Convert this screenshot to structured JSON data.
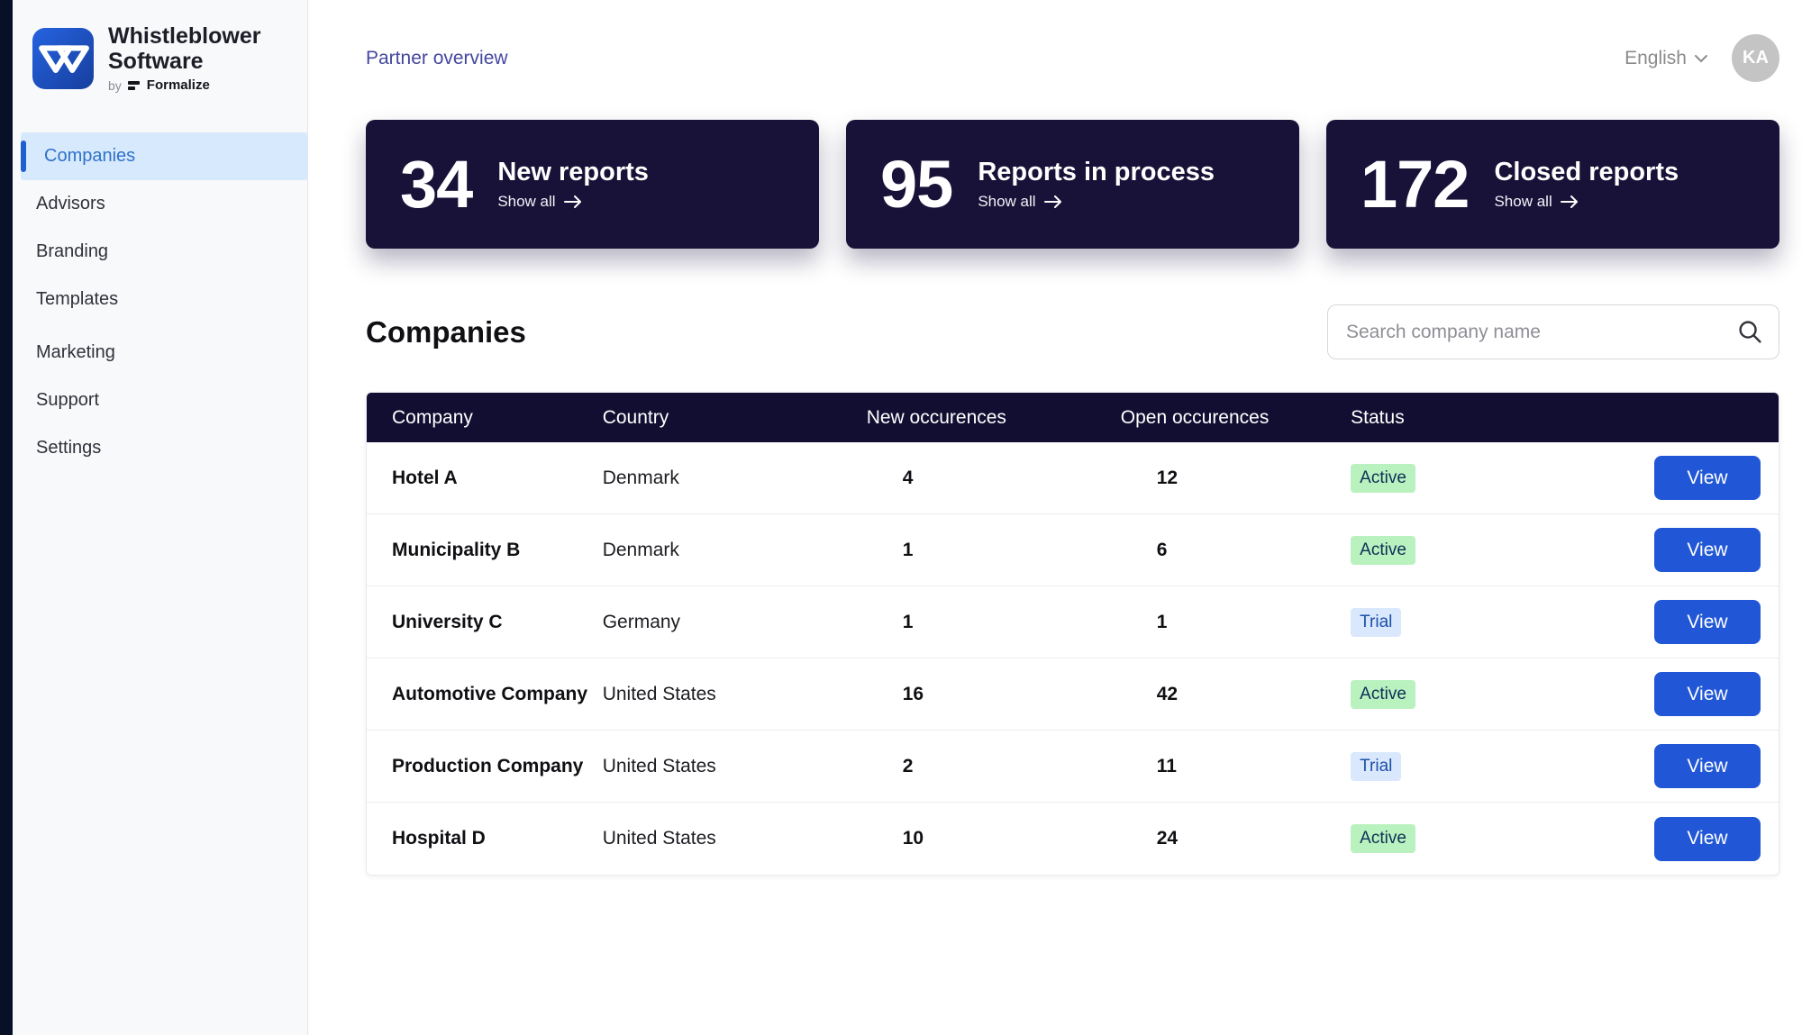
{
  "brand": {
    "name_line1": "Whistleblower",
    "name_line2": "Software",
    "byline_prefix": "by",
    "byline_brand": "Formalize"
  },
  "sidebar": {
    "items": [
      {
        "label": "Companies",
        "active": true
      },
      {
        "label": "Advisors"
      },
      {
        "label": "Branding"
      },
      {
        "label": "Templates"
      },
      {
        "label": "Marketing"
      },
      {
        "label": "Support"
      },
      {
        "label": "Settings"
      }
    ]
  },
  "topbar": {
    "breadcrumb": "Partner overview",
    "language": "English",
    "avatar_initials": "KA"
  },
  "stat_cards": [
    {
      "value": "34",
      "title": "New reports",
      "link_label": "Show all"
    },
    {
      "value": "95",
      "title": "Reports in process",
      "link_label": "Show all"
    },
    {
      "value": "172",
      "title": "Closed reports",
      "link_label": "Show all"
    }
  ],
  "companies_section": {
    "heading": "Companies",
    "search_placeholder": "Search company name"
  },
  "table": {
    "columns": [
      "Company",
      "Country",
      "New occurences",
      "Open occurences",
      "Status"
    ],
    "action_label": "View",
    "rows": [
      {
        "company": "Hotel A",
        "country": "Denmark",
        "new_occurences": "4",
        "open_occurences": "12",
        "status": "Active"
      },
      {
        "company": "Municipality B",
        "country": "Denmark",
        "new_occurences": "1",
        "open_occurences": "6",
        "status": "Active"
      },
      {
        "company": "University C",
        "country": "Germany",
        "new_occurences": "1",
        "open_occurences": "1",
        "status": "Trial"
      },
      {
        "company": "Automotive Company",
        "country": "United States",
        "new_occurences": "16",
        "open_occurences": "42",
        "status": "Active"
      },
      {
        "company": "Production Company",
        "country": "United States",
        "new_occurences": "2",
        "open_occurences": "11",
        "status": "Trial"
      },
      {
        "company": "Hospital D",
        "country": "United States",
        "new_occurences": "10",
        "open_occurences": "24",
        "status": "Active"
      }
    ]
  },
  "colors": {
    "accent": "#2157d7",
    "navy-card": "#181238",
    "navy-header": "#110e31",
    "sidebar-active-text": "#2e72c9",
    "breadcrumb": "#45479f",
    "logo-blue": "#1b52d1",
    "active-badge-bg": "#b9f2bf",
    "active-badge-text": "#0f2e57",
    "trial-badge-bg": "#d9e8fc",
    "trial-badge-text": "#1e4fa8"
  }
}
